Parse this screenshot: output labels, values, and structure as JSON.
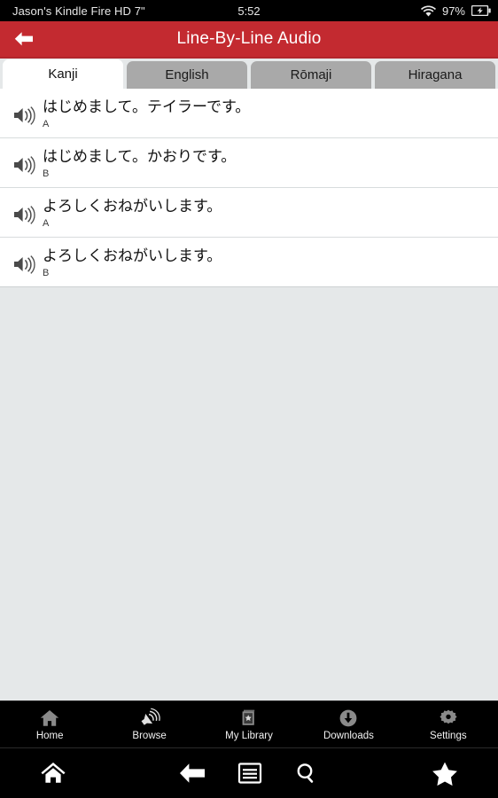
{
  "statusbar": {
    "device": "Jason's Kindle Fire HD 7\"",
    "time": "5:52",
    "battery_percent": "97%",
    "wifi_icon": "wifi-icon",
    "battery_icon": "battery-charging-icon"
  },
  "appbar": {
    "back_icon": "back-arrow-icon",
    "title": "Line-By-Line Audio",
    "color": "#c32a30"
  },
  "tabs": [
    {
      "label": "Kanji",
      "active": true
    },
    {
      "label": "English",
      "active": false
    },
    {
      "label": "Rōmaji",
      "active": false
    },
    {
      "label": "Hiragana",
      "active": false
    }
  ],
  "lines": [
    {
      "text": "はじめまして。テイラーです。",
      "speaker": "A",
      "play_icon": "speaker-icon"
    },
    {
      "text": "はじめまして。かおりです。",
      "speaker": "B",
      "play_icon": "speaker-icon"
    },
    {
      "text": "よろしくおねがいします。",
      "speaker": "A",
      "play_icon": "speaker-icon"
    },
    {
      "text": "よろしくおねがいします。",
      "speaker": "B",
      "play_icon": "speaker-icon"
    }
  ],
  "tabbar": [
    {
      "label": "Home",
      "icon": "home-icon"
    },
    {
      "label": "Browse",
      "icon": "broadcast-icon"
    },
    {
      "label": "My Library",
      "icon": "book-star-icon"
    },
    {
      "label": "Downloads",
      "icon": "download-circle-icon"
    },
    {
      "label": "Settings",
      "icon": "gear-icon"
    }
  ],
  "navbar": [
    {
      "icon": "home-icon"
    },
    {
      "icon": "back-arrow-icon"
    },
    {
      "icon": "menu-icon"
    },
    {
      "icon": "search-icon"
    },
    {
      "icon": "star-icon"
    }
  ],
  "colors": {
    "accent_red": "#c32a30",
    "page_background": "#e5e8e9",
    "tab_inactive": "#a9a9a9",
    "nav_background": "#000000"
  }
}
